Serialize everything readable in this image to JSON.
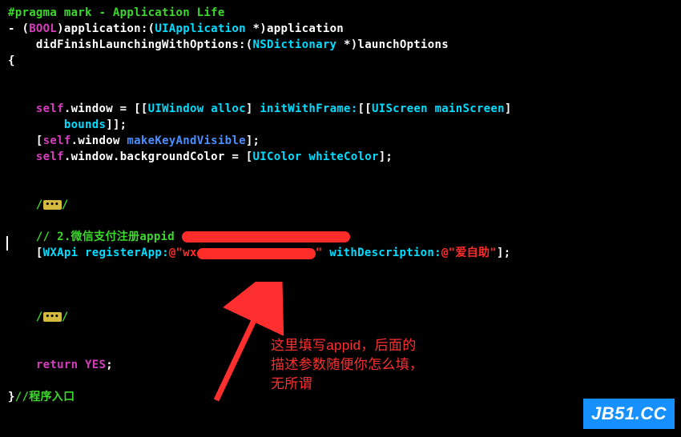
{
  "code": {
    "pragma_pre": "#",
    "pragma": "pragma mark - Application Life",
    "minus": "- ",
    "lparen": "(",
    "bool": "BOOL",
    "rparen_app": ")",
    "application_m": "application:",
    "lparen2": "(",
    "uiapp": "UIApplication",
    "star_app": " *)",
    "application_p": "application",
    "indent_didf": "    ",
    "didfinish": "didFinishLaunchingWithOptions:",
    "lparen3": "(",
    "nsdict": "NSDictionary",
    "star_lo": " *)",
    "launchopt": "launchOptions",
    "lbrace": "{",
    "self1_i": "    self",
    "dot1": ".",
    "window1": "window",
    "eq1": " = [[",
    "uiwindow": "UIWindow",
    "sp1": " ",
    "alloc": "alloc",
    "rb1": "] ",
    "initwith": "initWithFrame:",
    "lb2": "[[",
    "uiscreen": "UIScreen",
    "sp2": " ",
    "mainscr": "mainScreen",
    "rb2": "]",
    "bindent": "        ",
    "bounds": "bounds",
    "rb3": "]];",
    "lb4": "    [",
    "self2": "self",
    "dot2": ".",
    "window2": "window",
    "sp3": " ",
    "makekey": "makeKeyAndVisible",
    "rb4": "];",
    "self3_i": "    self",
    "dot3a": ".",
    "window3": "window",
    "dot3b": ".",
    "bgcolor": "backgroundColor",
    "eq2": " = [",
    "uicolor": "UIColor",
    "sp4": " ",
    "whitec": "whiteColor",
    "rb5": "];",
    "fold1_i": "    /",
    "fold1_c": "•••",
    "fold1_e": "/",
    "comment2_i": "    //",
    "comment2": " 2.微信支付注册appid ",
    "wx_lb": "    [",
    "wxapi": "WXApi",
    "sp5": " ",
    "regapp": "registerApp:",
    "at1": "@\"",
    "wxprefix": "wx",
    "wxhidden": "              ",
    "q1": "\"",
    "sp6": " ",
    "withdesc": "withDescription:",
    "at2": "@\"",
    "desc": "爱自助",
    "q2": "\"",
    "rb6": "];",
    "fold2_i": "    /",
    "fold2_c": "•••",
    "fold2_e": "/",
    "return_i": "    ",
    "return": "return",
    "sp7": " ",
    "yes": "YES",
    "semi": ";",
    "rbrace": "}",
    "entrycomment": "//程序入口"
  },
  "annotation": {
    "line1": "这里填写appid，后面的",
    "line2": "描述参数随便你怎么填，",
    "line3": "无所谓"
  },
  "watermark": "JB51.CC"
}
